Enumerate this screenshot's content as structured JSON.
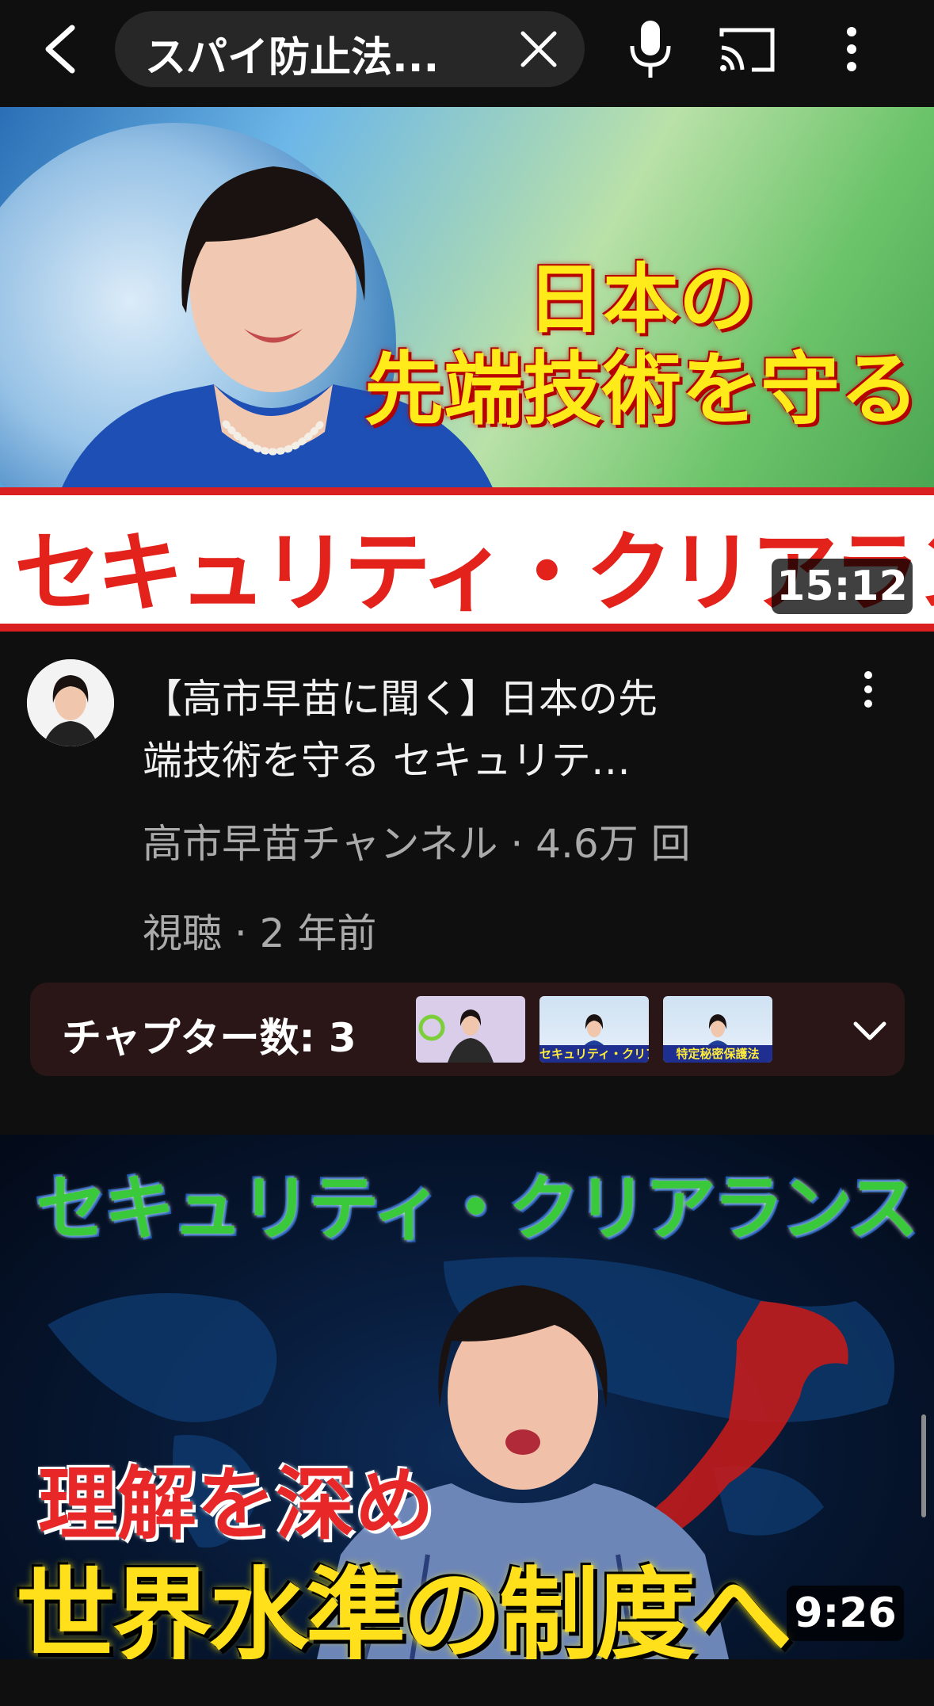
{
  "search": {
    "query": "スパイ防止法..."
  },
  "video1": {
    "thumb_text_line1": "日本の",
    "thumb_text_line2": "先端技術を守る",
    "thumb_banner": "セキュリティ・クリアランス",
    "duration": "15:12",
    "title_line1": "【高市早苗に聞く】日本の先",
    "title_line2": "端技術を守る セキュリテ…",
    "meta_line1": "高市早苗チャンネル · 4.6万 回",
    "meta_line2": "視聴 · 2 年前",
    "chapters_label": "チャプター数: 3",
    "chapter_captions": [
      "",
      "セキュリティ・クリアランス",
      "特定秘密保護法"
    ]
  },
  "video2": {
    "thumb_top": "セキュリティ・クリアランス",
    "thumb_mid": "理解を深め",
    "thumb_bottom": "世界水準の制度へ",
    "duration": "9:26"
  },
  "colors": {
    "background": "#0f0f0f",
    "search_pill": "#272727",
    "chapter_panel": "#2a1616",
    "secondary_text": "#aaaaaa",
    "banner_red": "#e3231b",
    "thumb_yellow": "#ffeb1a"
  },
  "icons": {
    "back": "chevron-left-icon",
    "clear": "close-icon",
    "mic": "microphone-icon",
    "cast": "cast-icon",
    "more": "more-vertical-icon",
    "expand": "chevron-down-icon"
  }
}
